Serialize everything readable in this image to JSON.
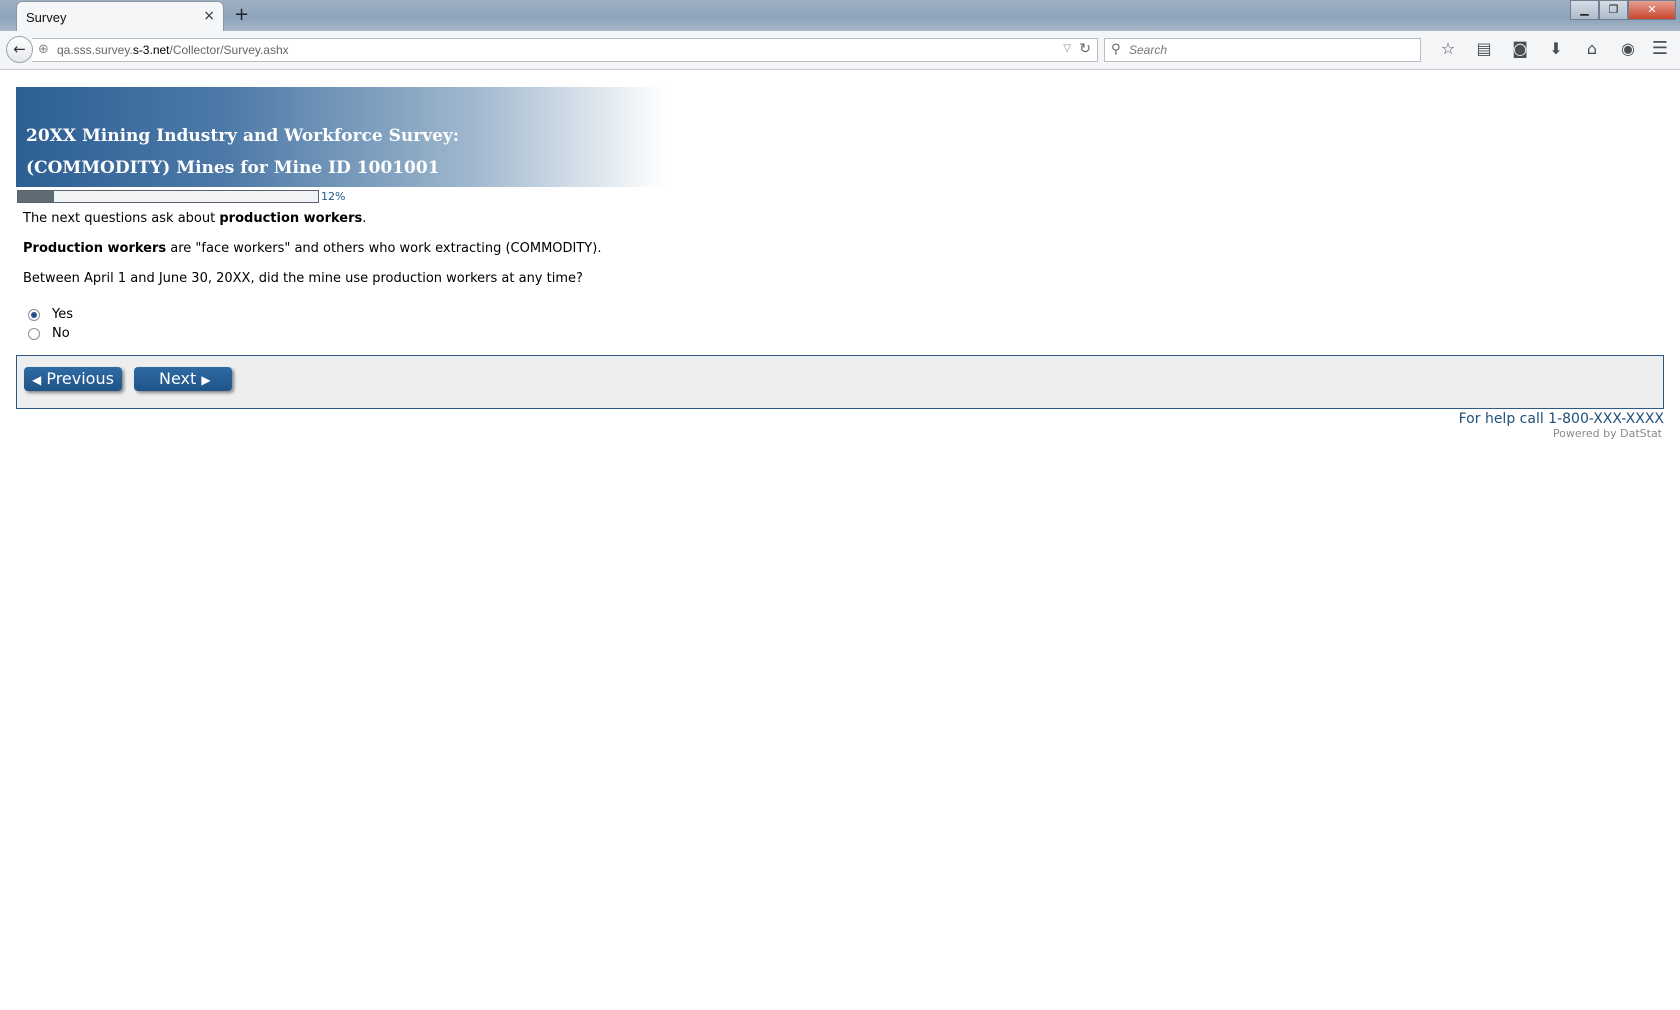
{
  "browser": {
    "tab_title": "Survey",
    "tab_close": "×",
    "new_tab": "+",
    "url_host_prefix": "qa.sss.survey.",
    "url_host_bold": "s-3.net",
    "url_path": "/Collector/Survey.ashx",
    "search_placeholder": "Search",
    "window_controls": {
      "minimize": "▁",
      "restore": "❐",
      "close": "✕"
    }
  },
  "survey": {
    "title_line1": "20XX Mining Industry and Workforce Survey:",
    "title_line2": "(COMMODITY) Mines for Mine ID 1001001",
    "progress_percent": 12,
    "progress_label": "12%",
    "q1_pre": "The next questions ask about ",
    "q1_bold": "production workers",
    "q1_post": ".",
    "q2_bold": "Production workers",
    "q2_rest": " are \"face workers\" and others who work extracting (COMMODITY).",
    "q3": "Between April 1 and June 30, 20XX, did the mine use production workers at any time?",
    "options": [
      {
        "label": "Yes",
        "selected": true
      },
      {
        "label": "No",
        "selected": false
      }
    ],
    "previous_label": "Previous",
    "next_label": "Next",
    "help_text": "For help call 1-800-XXX-XXXX",
    "powered_by": "Powered by DatStat"
  },
  "colors": {
    "accent": "#1f5487",
    "progress_fill": "#5f6b73",
    "panel_bg": "#eeeeee"
  }
}
